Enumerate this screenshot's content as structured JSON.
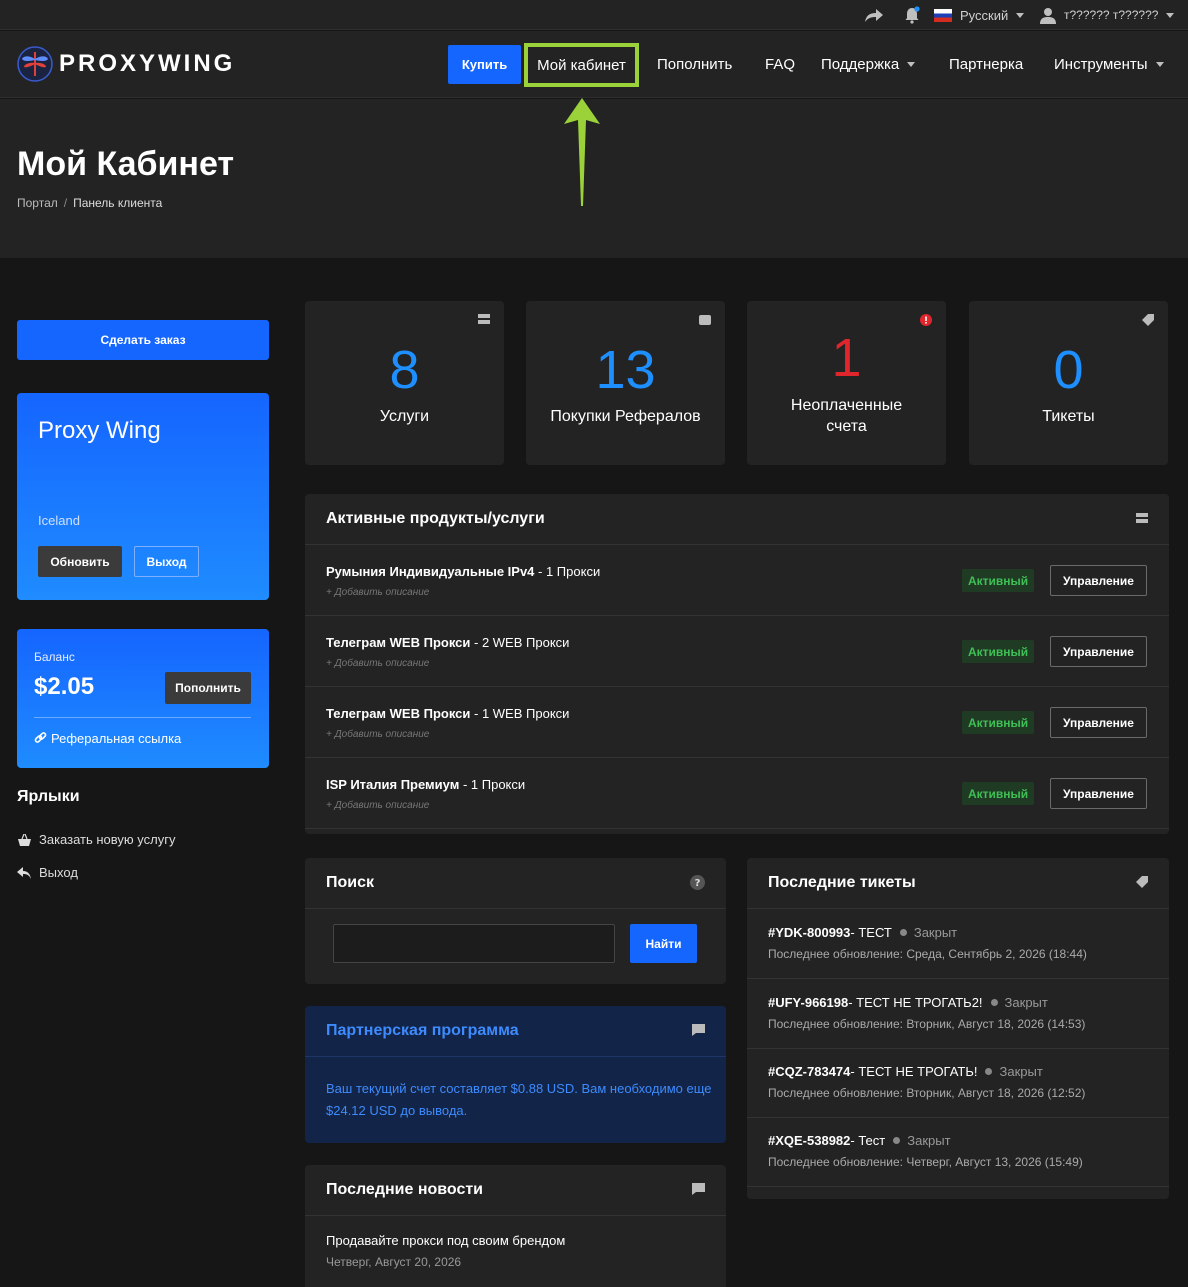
{
  "topbar": {
    "language": "Русский",
    "user": "т?????? т??????",
    "flag_colors": [
      "#ffffff",
      "#1c3fb5",
      "#d52b1e"
    ]
  },
  "nav": {
    "logo": "PROXYWING",
    "buy": "Купить",
    "cabinet": "Мой кабинет",
    "topup": "Пополнить",
    "faq": "FAQ",
    "support": "Поддержка",
    "partner": "Партнерка",
    "tools": "Инструменты"
  },
  "header": {
    "title": "Мой Кабинет",
    "breadcrumb": [
      "Портал",
      "/",
      "Панель клиента"
    ]
  },
  "sidebar": {
    "order_button": "Сделать заказ",
    "profile": {
      "name": "Proxy Wing",
      "country": "Iceland",
      "update": "Обновить",
      "logout": "Выход"
    },
    "balance": {
      "label": "Баланс",
      "value": "$2.05",
      "topup": "Пополнить",
      "ref_link": "Реферальная ссылка"
    },
    "shortcuts_title": "Ярлыки",
    "shortcuts": [
      {
        "label": "Заказать новую услугу",
        "icon": "basket-icon"
      },
      {
        "label": "Выход",
        "icon": "back-arrow-icon"
      }
    ]
  },
  "stats": [
    {
      "value": "8",
      "label": "Услуги",
      "icon": "server-icon"
    },
    {
      "value": "13",
      "label": "Покупки Рефералов",
      "icon": "wallet-icon"
    },
    {
      "value": "1",
      "label": "Неоплаченные счета",
      "icon": "alert-icon"
    },
    {
      "value": "0",
      "label": "Тикеты",
      "icon": "tag-icon"
    }
  ],
  "services": {
    "title": "Активные продукты/услуги",
    "rows": [
      {
        "name": "Румыния Индивидуальные IPv4",
        "detail": " - 1 Прокси",
        "desc": "+ Добавить описание",
        "status": "Активный",
        "action": "Управление"
      },
      {
        "name": "Телеграм WEB Прокси",
        "detail": " - 2 WEB Прокси",
        "desc": "+ Добавить описание",
        "status": "Активный",
        "action": "Управление"
      },
      {
        "name": "Телеграм WEB Прокси",
        "detail": " - 1 WEB Прокси",
        "desc": "+ Добавить описание",
        "status": "Активный",
        "action": "Управление"
      },
      {
        "name": "ISP Италия Премиум",
        "detail": " - 1 Прокси",
        "desc": "+ Добавить описание",
        "status": "Активный",
        "action": "Управление"
      }
    ]
  },
  "search": {
    "title": "Поиск",
    "button": "Найти",
    "value": ""
  },
  "partner": {
    "title": "Партнерская программа",
    "text": "Ваш текущий счет составляет $0.88 USD. Вам необходимо еще $24.12 USD до вывода."
  },
  "news": {
    "title": "Последние новости",
    "item_title": "Продавайте прокси под своим брендом",
    "item_date": "Четверг, Август 20, 2026"
  },
  "tickets": {
    "title": "Последние тикеты",
    "items": [
      {
        "id": "#YDK-800993",
        "subject": " - ТЕСТ",
        "status": "Закрыт",
        "updated": "Последнее обновление: Среда, Сентябрь 2, 2026 (18:44)"
      },
      {
        "id": "#UFY-966198",
        "subject": " - ТЕСТ НЕ ТРОГАТЬ2!",
        "status": "Закрыт",
        "updated": "Последнее обновление: Вторник, Август 18, 2026 (14:53)"
      },
      {
        "id": "#CQZ-783474",
        "subject": " - ТЕСТ НЕ ТРОГАТЬ!",
        "status": "Закрыт",
        "updated": "Последнее обновление: Вторник, Август 18, 2026 (12:52)"
      },
      {
        "id": "#XQE-538982",
        "subject": " - Тест",
        "status": "Закрыт",
        "updated": "Последнее обновление: Четверг, Август 13, 2026 (15:49)"
      }
    ]
  }
}
